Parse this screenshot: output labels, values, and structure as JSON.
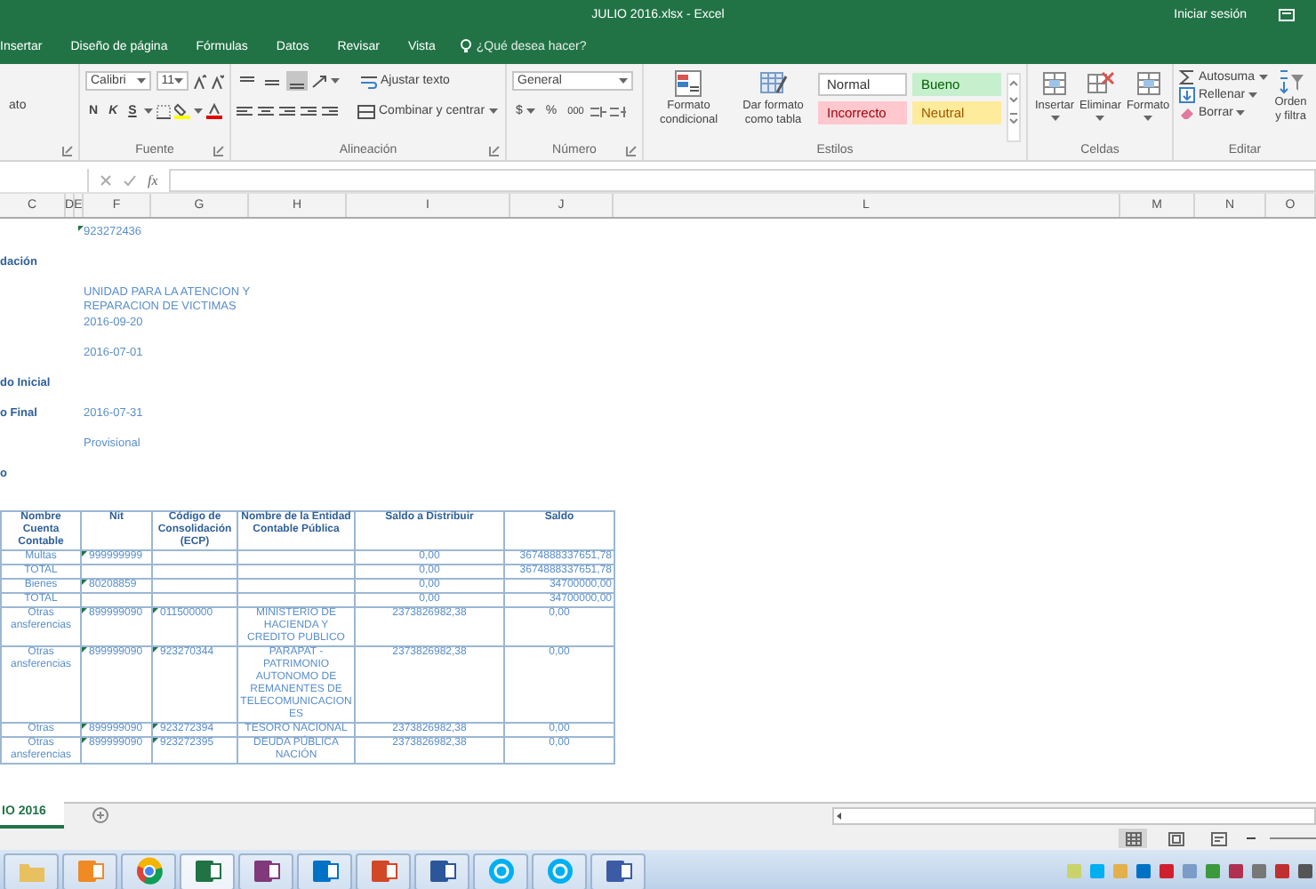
{
  "window": {
    "title": "JULIO 2016.xlsx - Excel",
    "sign_in": "Iniciar sesión"
  },
  "ribbon_tabs": [
    {
      "label": "Insertar",
      "selected": false
    },
    {
      "label": "Diseño de página",
      "selected": false
    },
    {
      "label": "Fórmulas",
      "selected": false
    },
    {
      "label": "Datos",
      "selected": false
    },
    {
      "label": "Revisar",
      "selected": false
    },
    {
      "label": "Vista",
      "selected": false
    }
  ],
  "tell_me": "¿Qué desea hacer?",
  "ribbon": {
    "clipboard": {
      "format_painter": "ato"
    },
    "font": {
      "name": "Calibri",
      "size": "11",
      "bold": "N",
      "italic": "K",
      "underline": "S",
      "group": "Fuente"
    },
    "alignment": {
      "vertical": [
        {
          "selected": false
        },
        {
          "selected": false
        },
        {
          "selected": true
        }
      ],
      "wrap": "Ajustar texto",
      "merge": "Combinar y centrar",
      "group": "Alineación"
    },
    "number": {
      "format": "General",
      "currency": "$",
      "percent": "%",
      "thousands": "000",
      "group": "Número"
    },
    "styles": {
      "conditional": "Formato condicional",
      "table": "Dar formato como tabla",
      "cells": [
        {
          "label": "Normal",
          "kind": "normal"
        },
        {
          "label": "Bueno",
          "kind": "good"
        },
        {
          "label": "Incorrecto",
          "kind": "bad"
        },
        {
          "label": "Neutral",
          "kind": "neutral"
        }
      ],
      "group": "Estilos"
    },
    "cells": {
      "buttons": [
        "Insertar",
        "Eliminar",
        "Formato"
      ],
      "group": "Celdas"
    },
    "editing": {
      "items": [
        "Autosuma",
        "Rellenar",
        "Borrar"
      ],
      "sort": "Orden y filtra",
      "group": "Editar"
    }
  },
  "formula_bar": {
    "fx": "fx"
  },
  "columns": [
    "C",
    "D",
    "E",
    "F",
    "G",
    "H",
    "I",
    "J",
    "L",
    "M",
    "N",
    "O"
  ],
  "info": [
    {
      "value": "923272436",
      "flagged": true
    },
    {
      "label": "dación",
      "flagged": false
    },
    {
      "value": "UNIDAD PARA LA ATENCION Y REPARACION DE VICTIMAS",
      "flagged": false
    },
    {
      "value": "2016-09-20",
      "flagged": false
    },
    {
      "value": "2016-07-01",
      "flagged": false
    },
    {
      "label": "do Inicial",
      "flagged": false
    },
    {
      "label": "o Final",
      "value": "2016-07-31",
      "flagged": false
    },
    {
      "value": "Provisional",
      "flagged": false
    },
    {
      "label": "o",
      "flagged": false
    }
  ],
  "table": {
    "columns": [
      "Nombre Cuenta Contable",
      "Nit",
      "Código de Consolidación (ECP)",
      "Nombre de la Entidad Contable Pública",
      "Saldo a Distribuir",
      "Saldo"
    ],
    "rows": [
      {
        "account": "Multas",
        "nit": "999999999",
        "to_distribute": "0,00",
        "balance": "3674888337651,78",
        "flagged": true
      },
      {
        "account": "TOTAL",
        "to_distribute": "0,00",
        "balance": "3674888337651,78",
        "flagged": false
      },
      {
        "account": "Bienes",
        "nit": "80208859",
        "to_distribute": "0,00",
        "balance": "34700000,00",
        "flagged": true
      },
      {
        "account": "TOTAL",
        "to_distribute": "0,00",
        "balance": "34700000,00",
        "flagged": false
      },
      {
        "account": "Otras ansferencias",
        "nit": "899999090",
        "code": "011500000",
        "entity": "MINISTERIO DE HACIENDA Y CREDITO PUBLICO",
        "to_distribute": "2373826982,38",
        "balance": "0,00",
        "flagged": true
      },
      {
        "account": "Otras ansferencias",
        "nit": "899999090",
        "code": "923270344",
        "entity": "PARAPAT - PATRIMONIO AUTONOMO DE REMANENTES DE TELECOMUNICACIONES",
        "to_distribute": "2373826982,38",
        "balance": "0,00",
        "flagged": true
      },
      {
        "account": "Otras",
        "nit": "899999090",
        "code": "923272394",
        "entity": "TESORO NACIONAL",
        "to_distribute": "2373826982,38",
        "balance": "0,00",
        "flagged": true
      },
      {
        "account": "Otras ansferencias",
        "nit": "899999090",
        "code": "923272395",
        "entity": "DEUDA PÚBLICA NACIÓN",
        "to_distribute": "2373826982,38",
        "balance": "0,00",
        "flagged": true
      }
    ]
  },
  "sheet_tabs": [
    {
      "label": "IO 2016",
      "selected": true
    }
  ]
}
